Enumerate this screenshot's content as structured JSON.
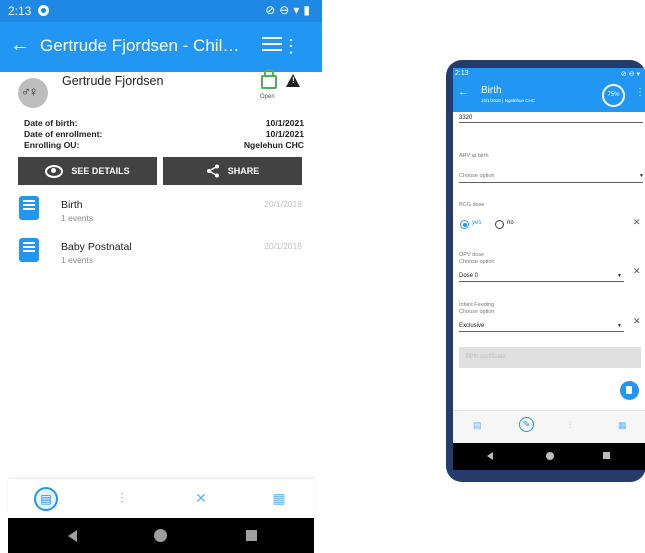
{
  "left_phone": {
    "status_time": "2:13",
    "appbar": {
      "back_glyph": "←",
      "title": "Gertrude Fjordsen - Child ...",
      "menu_glyph": "⋮"
    },
    "person": {
      "name": "Gertrude Fjordsen",
      "lock_state": "Open"
    },
    "info": [
      {
        "label": "Date of birth:",
        "value": "10/1/2021"
      },
      {
        "label": "Date of enrollment:",
        "value": "10/1/2021"
      },
      {
        "label": "Enrolling OU:",
        "value": "Ngelehun CHC"
      }
    ],
    "buttons": {
      "details": "SEE DETAILS",
      "share": "SHARE"
    },
    "events": [
      {
        "name": "Birth",
        "count": "1 events",
        "date": "20/1/2018"
      },
      {
        "name": "Baby Postnatal",
        "count": "1 events",
        "date": "20/1/2018"
      }
    ],
    "colors": {
      "primary": "#2196f3",
      "status_bar": "#1e88e5",
      "button": "#424242"
    }
  },
  "right_phone": {
    "status_time": "2:13",
    "header": {
      "title": "Birth",
      "subtitle": "10/1/2020 | Ngelehun CHC",
      "progress": "75%"
    },
    "fields": {
      "top_value": "3320",
      "arv_label": "ARV at birth",
      "arv_placeholder": "Choose option",
      "bcg_label": "BCG dose",
      "bcg_yes": "yes",
      "bcg_no": "no",
      "opv_label": "OPV dose",
      "opv_hint": "Choose option",
      "opv_value": "Dose 0",
      "feeding_label": "Infant Feeding",
      "feeding_hint": "Choose option",
      "feeding_value": "Exclusive",
      "certificate_button": "Birth certificate"
    }
  }
}
